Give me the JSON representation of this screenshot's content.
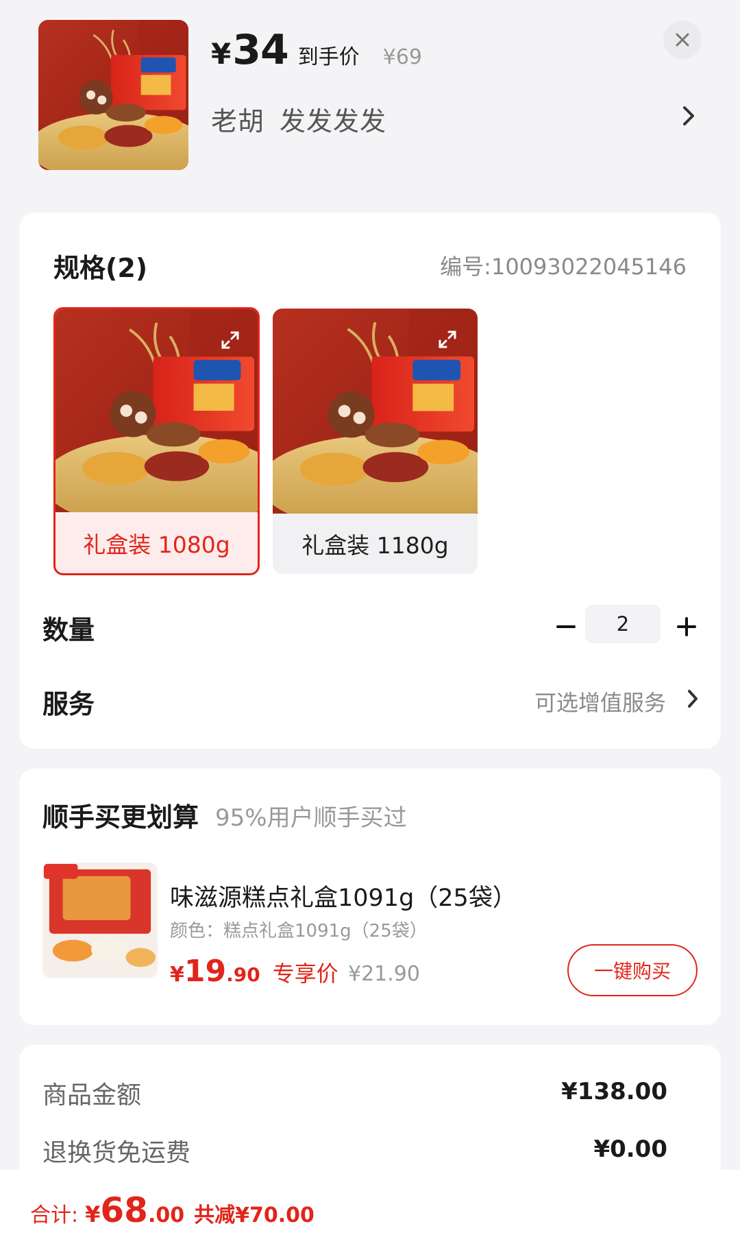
{
  "header": {
    "currency": "¥",
    "price": "34",
    "price_tag": "到手价",
    "original_price": "¥69",
    "seller_name": "老胡",
    "seller_note": "发发发发",
    "close_icon": "close-icon",
    "chevron_icon": "chevron-right-icon"
  },
  "spec": {
    "title": "规格(2)",
    "code": "编号:10093022045146",
    "options": [
      {
        "label": "礼盒装 1080g",
        "selected": true
      },
      {
        "label": "礼盒装 1180g",
        "selected": false
      }
    ]
  },
  "quantity": {
    "label": "数量",
    "value": "2"
  },
  "service": {
    "label": "服务",
    "hint": "可选增值服务"
  },
  "combo": {
    "title": "顺手买更划算",
    "subtitle": "95%用户顺手买过",
    "product_name": "味滋源糕点礼盒1091g（25袋）",
    "product_color": "颜色：糕点礼盒1091g（25袋）",
    "price_yen": "¥",
    "price_int": "19",
    "price_dec": ".90",
    "price_tag": "专享价",
    "original_price": "¥21.90",
    "buy_label": "一键购买"
  },
  "summary": {
    "rows": [
      {
        "label": "商品金额",
        "value": "¥138.00"
      },
      {
        "label": "退换货免运费",
        "value": "¥0.00"
      }
    ]
  },
  "bottom": {
    "total_label": "合计:",
    "total_yen": "¥",
    "total_int": "68",
    "total_dec": ".00",
    "saving": "共减¥70.00"
  },
  "colors": {
    "accent": "#e1251b",
    "background": "#f4f4f6",
    "card": "#ffffff"
  }
}
